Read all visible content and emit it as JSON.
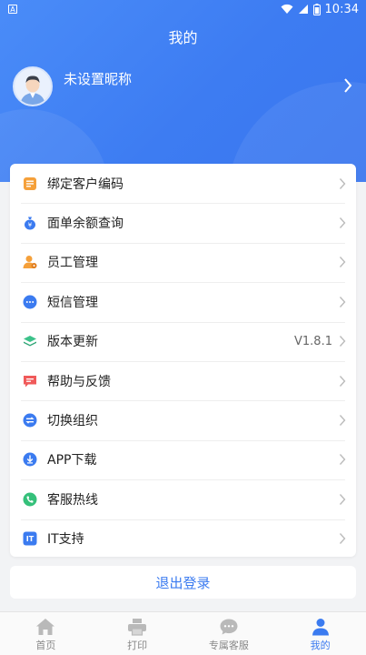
{
  "status_bar": {
    "time": "10:34",
    "left_glyph": "A"
  },
  "header": {
    "title": "我的"
  },
  "profile": {
    "nickname": "未设置昵称"
  },
  "menu": {
    "items": [
      {
        "label": "绑定客户编码",
        "icon": "document-list-icon",
        "color": "#f5a03a"
      },
      {
        "label": "面单余额查询",
        "icon": "money-bag-icon",
        "color": "#3b7bf0"
      },
      {
        "label": "员工管理",
        "icon": "employee-icon",
        "color": "#f5a03a"
      },
      {
        "label": "短信管理",
        "icon": "sms-bubble-icon",
        "color": "#3b7bf0"
      },
      {
        "label": "版本更新",
        "icon": "layers-icon",
        "color": "#3cc28a",
        "value": "V1.8.1"
      },
      {
        "label": "帮助与反馈",
        "icon": "feedback-icon",
        "color": "#f05a5a"
      },
      {
        "label": "切换组织",
        "icon": "switch-icon",
        "color": "#3b7bf0"
      },
      {
        "label": "APP下载",
        "icon": "download-icon",
        "color": "#3b7bf0"
      },
      {
        "label": "客服热线",
        "icon": "phone-icon",
        "color": "#35c07a"
      },
      {
        "label": "IT支持",
        "icon": "it-support-icon",
        "color": "#3b7bf0"
      }
    ]
  },
  "logout_label": "退出登录",
  "tabs": [
    {
      "label": "首页",
      "icon": "home-icon"
    },
    {
      "label": "打印",
      "icon": "printer-icon"
    },
    {
      "label": "专属客服",
      "icon": "chat-icon"
    },
    {
      "label": "我的",
      "icon": "user-icon",
      "active": true
    }
  ],
  "colors": {
    "primary": "#3b7bf0",
    "background": "#f2f3f5"
  }
}
